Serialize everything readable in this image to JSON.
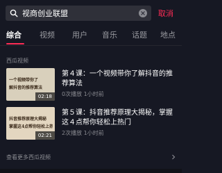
{
  "search": {
    "query": "视商创业联盟",
    "cancel_label": "取消"
  },
  "tabs": [
    {
      "label": "综合",
      "active": true
    },
    {
      "label": "视频",
      "active": false
    },
    {
      "label": "用户",
      "active": false
    },
    {
      "label": "音乐",
      "active": false
    },
    {
      "label": "话题",
      "active": false
    },
    {
      "label": "地点",
      "active": false
    }
  ],
  "section": {
    "title": "西瓜视频",
    "more_label": "查看更多西瓜视频",
    "videos": [
      {
        "title": "第４课：一个视频带你了解抖音的推荐算法",
        "meta": "0次播放 1小时前",
        "duration": "02:18",
        "thumb_line1": "一个视频带你了",
        "thumb_line2": "解抖音的推荐算法"
      },
      {
        "title": "第５课：抖音推荐原理大揭秘，掌握这４点帮你轻松上热门",
        "meta": "2次播放 1小时前",
        "duration": "02:21",
        "thumb_line1": "抖音推荐原理大揭秘",
        "thumb_line2": "掌握这4点帮你轻松上热门"
      }
    ]
  },
  "colors": {
    "background": "#161823",
    "accent": "#fe2c55",
    "muted_text": "#8a8b91"
  }
}
